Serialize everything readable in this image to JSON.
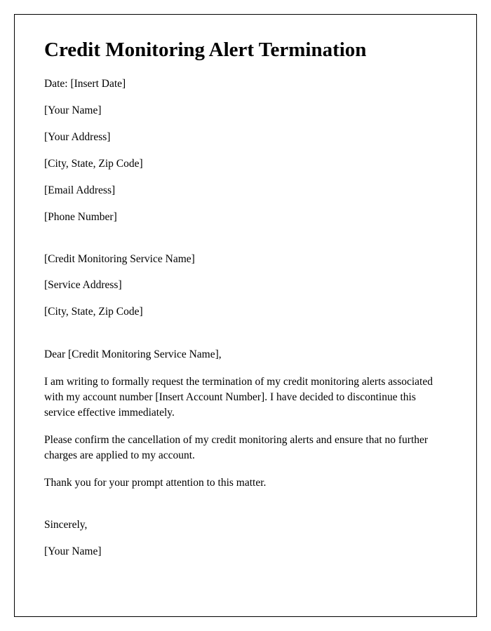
{
  "title": "Credit Monitoring Alert Termination",
  "sender": {
    "date": "Date: [Insert Date]",
    "name": "[Your Name]",
    "address": "[Your Address]",
    "city_state_zip": "[City, State, Zip Code]",
    "email": "[Email Address]",
    "phone": "[Phone Number]"
  },
  "recipient": {
    "service_name": "[Credit Monitoring Service Name]",
    "address": "[Service Address]",
    "city_state_zip": "[City, State, Zip Code]"
  },
  "salutation": "Dear [Credit Monitoring Service Name],",
  "body": {
    "p1": "I am writing to formally request the termination of my credit monitoring alerts associated with my account number [Insert Account Number]. I have decided to discontinue this service effective immediately.",
    "p2": "Please confirm the cancellation of my credit monitoring alerts and ensure that no further charges are applied to my account.",
    "p3": "Thank you for your prompt attention to this matter."
  },
  "closing": {
    "signoff": "Sincerely,",
    "name": "[Your Name]"
  }
}
